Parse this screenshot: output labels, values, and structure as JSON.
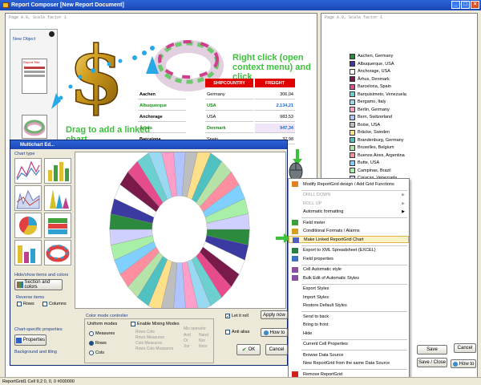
{
  "window": {
    "title": "Report Composer [New Report Document]"
  },
  "left_page": {
    "header": "Page A.8, Scale factor 1"
  },
  "right_page": {
    "header": "Page A.9, Scale factor 1"
  },
  "new_object": {
    "title": "New Object",
    "thumb_title": "Report Title"
  },
  "grid": {
    "headers": [
      "SHIPCITY",
      "SHIPCOUNTRY",
      "FREIGHT"
    ],
    "rows": [
      {
        "city": "Aachen",
        "country": "Germany",
        "freight": "306,04"
      },
      {
        "city": "Albuquerque",
        "country": "USA",
        "freight": "2.134,21"
      },
      {
        "city": "Anchorage",
        "country": "USA",
        "freight": "983,53"
      },
      {
        "city": "Århus",
        "country": "Denmark",
        "freight": "947,34"
      },
      {
        "city": "Barcelona",
        "country": "Spain",
        "freight": "37,98"
      }
    ]
  },
  "legend": [
    {
      "label": "Aachen, Germany",
      "color": "#2b8a3e"
    },
    {
      "label": "Albuquerque, USA",
      "color": "#3a3aa0"
    },
    {
      "label": "Anchorage, USA",
      "color": "#ffffff"
    },
    {
      "label": "Århus, Denmark",
      "color": "#7a1a4a"
    },
    {
      "label": "Barcelona, Spain",
      "color": "#e64b8c"
    },
    {
      "label": "Barquisimeto, Venezuela",
      "color": "#6cd0d0"
    },
    {
      "label": "Bergamo, Italy",
      "color": "#9ad9f2"
    },
    {
      "label": "Berlin, Germany",
      "color": "#ff9ec9"
    },
    {
      "label": "Bern, Switzerland",
      "color": "#b0c4ff"
    },
    {
      "label": "Boise, USA",
      "color": "#bebebe"
    },
    {
      "label": "Bräcke, Sweden",
      "color": "#ffe08a"
    },
    {
      "label": "Brandenburg, Germany",
      "color": "#4fc1c1"
    },
    {
      "label": "Bruxelles, Belgium",
      "color": "#b6e3a8"
    },
    {
      "label": "Buenos Aires, Argentina",
      "color": "#ff8fa0"
    },
    {
      "label": "Butte, USA",
      "color": "#7fd0ff"
    },
    {
      "label": "Campinas, Brazil",
      "color": "#a8f0a8"
    },
    {
      "label": "Caracas, Venezuela",
      "color": "#d0d0ff"
    }
  ],
  "annotations": {
    "right_click": "Right click (open context menu) and click",
    "drag": "Drag to add a linked chart"
  },
  "dialog": {
    "title": "Multichart Ed...",
    "chart_type_label": "Chart type",
    "hide_show_label": "Hide/show items and colors",
    "section_colors_btn": "Section and colors",
    "reverse_items_label": "Reverse items",
    "rows_label": "Rows",
    "columns_label": "Columns",
    "chart_specific_label": "Chart-specific properties",
    "properties_btn": "Properties",
    "background_label": "Background and tiling",
    "color_mode_label": "Color mode controller",
    "uniform_modes": "Uniform modes",
    "measures": "Measures",
    "rows": "Rows",
    "cols": "Cols",
    "enable_mixing": "Enable Mixing Modes",
    "mix_options": [
      "Rows Cols",
      "Rows Measures",
      "Cols Measures",
      "Rows Cols Measures"
    ],
    "mix_operator": "Mix operator",
    "ops": [
      "And",
      "Nand",
      "Or",
      "Nor",
      "Xor",
      "Nxor"
    ],
    "let_it_roll": "Let it roll",
    "anti_alias": "Anti alias",
    "apply_now": "Apply now",
    "how_to": "How to",
    "ok": "OK",
    "cancel": "Cancel"
  },
  "context_menu": {
    "items": [
      {
        "label": "Modify ReportGrid design  / Add Grid Functions",
        "disabled": false,
        "arrow": false,
        "icon": "#e08020"
      },
      {
        "label": "DRILL DOWN",
        "disabled": true,
        "arrow": true,
        "icon": ""
      },
      {
        "label": "ROLL UP",
        "disabled": true,
        "arrow": true,
        "icon": ""
      },
      {
        "label": "Automatic formatting",
        "disabled": false,
        "arrow": true,
        "icon": ""
      },
      {
        "label": "Field meter",
        "disabled": false,
        "arrow": false,
        "icon": "#3aa040"
      },
      {
        "label": "Conditional Formats / Alarms",
        "disabled": false,
        "arrow": false,
        "icon": "#d8a020"
      },
      {
        "label": "Make Linked ReportGrid Chart",
        "disabled": false,
        "arrow": false,
        "icon": "#5060c0",
        "highlight": true
      },
      {
        "label": "Export to XML Spreadsheet (EXCEL)",
        "disabled": false,
        "arrow": false,
        "icon": "#2a8040"
      },
      {
        "label": "Field properties",
        "disabled": false,
        "arrow": false,
        "icon": "#4070c0"
      },
      {
        "label": "Cell Automatic style",
        "disabled": false,
        "arrow": false,
        "icon": "#8a50a0"
      },
      {
        "label": "Bulk Edit of Automatic Styles",
        "disabled": false,
        "arrow": false,
        "icon": "#8a50a0"
      },
      {
        "label": "Export Styles",
        "disabled": false,
        "arrow": false,
        "icon": ""
      },
      {
        "label": "Import Styles",
        "disabled": false,
        "arrow": false,
        "icon": ""
      },
      {
        "label": "Restore Default Styles",
        "disabled": false,
        "arrow": false,
        "icon": ""
      },
      {
        "label": "Send to back",
        "disabled": false,
        "arrow": false,
        "icon": ""
      },
      {
        "label": "Bring to front",
        "disabled": false,
        "arrow": false,
        "icon": ""
      },
      {
        "label": "Hide",
        "disabled": false,
        "arrow": false,
        "icon": ""
      },
      {
        "label": "Current Cell Properties",
        "disabled": false,
        "arrow": false,
        "icon": ""
      },
      {
        "label": "Browse Data Source",
        "disabled": false,
        "arrow": false,
        "icon": ""
      },
      {
        "label": "New ReportGrid from the same Data Source",
        "disabled": false,
        "arrow": false,
        "icon": ""
      },
      {
        "label": "Remove ReportGrid",
        "disabled": false,
        "arrow": false,
        "icon": "#d02020"
      }
    ]
  },
  "right_buttons": {
    "save": "Save",
    "cancel": "Cancel",
    "save_close": "Save / Close",
    "how_to": "How to"
  },
  "status_bar": "ReportGrid1  Cell 9,2  0, 0, 0 #000000",
  "colors": {
    "accent": "#2a63d6",
    "note_green": "#3bc13b",
    "header_red": "#e00000"
  }
}
